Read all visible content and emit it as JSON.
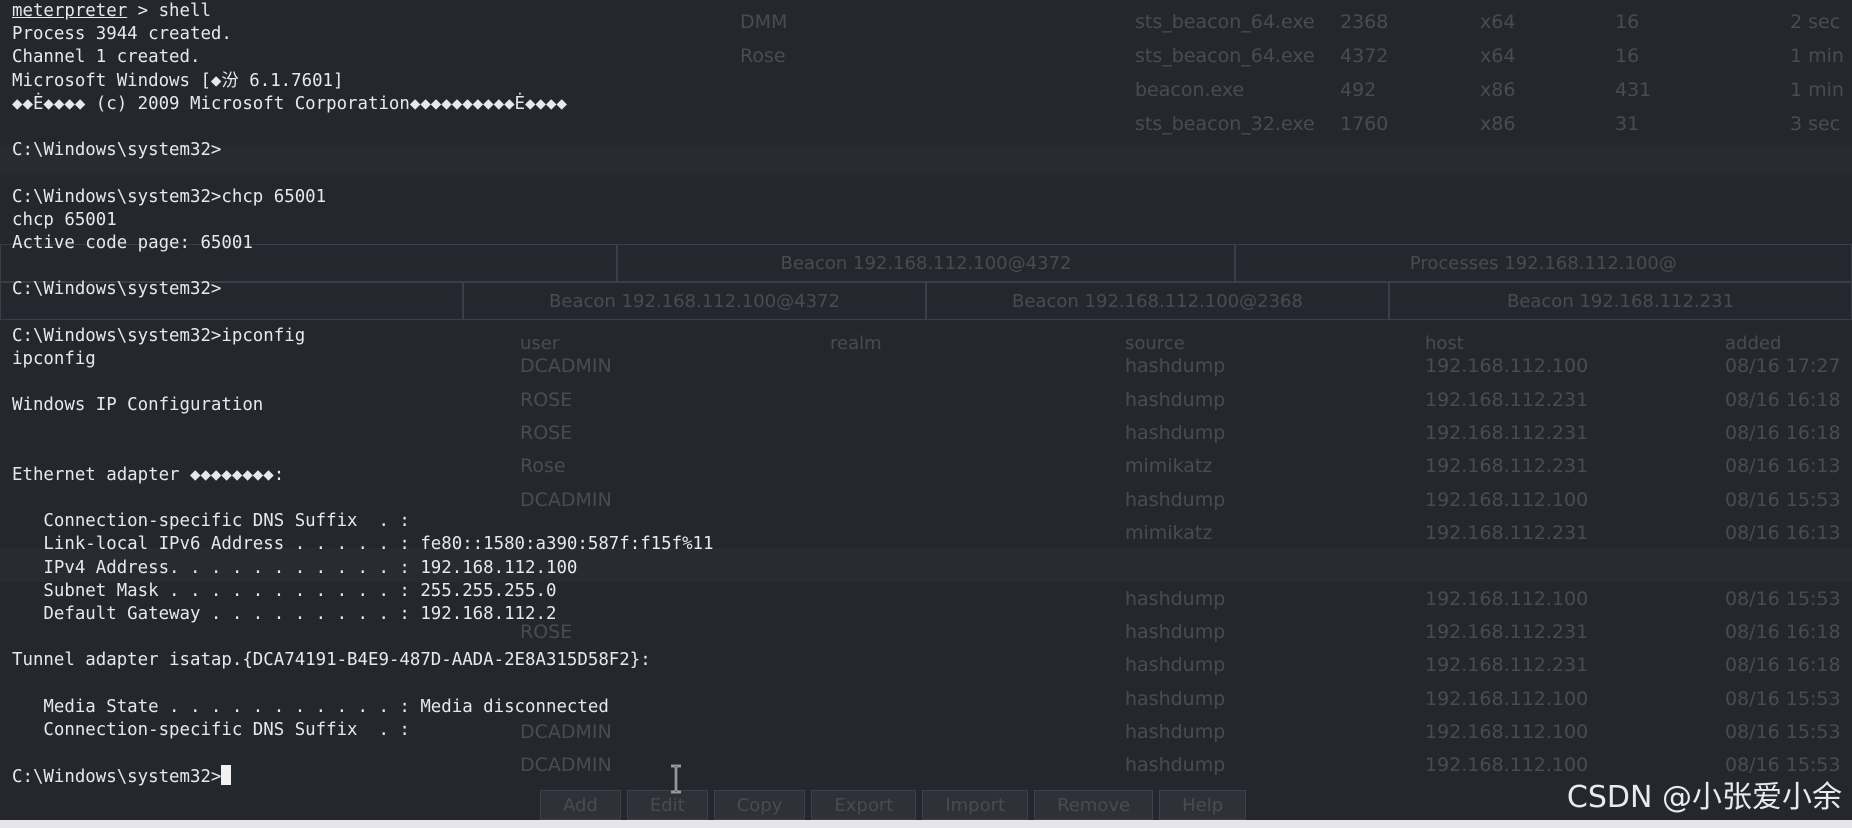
{
  "terminal": {
    "lines": [
      {
        "prefix": "meterpreter",
        "text": " > shell"
      },
      {
        "text": "Process 3944 created."
      },
      {
        "text": "Channel 1 created."
      },
      {
        "text": "Microsoft Windows [◆汾 6.1.7601]"
      },
      {
        "text": "◆◆Ė◆◆◆◆ (c) 2009 Microsoft Corporation◆◆◆◆◆◆◆◆◆◆Ė◆◆◆◆"
      },
      {
        "text": ""
      },
      {
        "text": "C:\\Windows\\system32>"
      },
      {
        "text": ""
      },
      {
        "text": "C:\\Windows\\system32>chcp 65001"
      },
      {
        "text": "chcp 65001"
      },
      {
        "text": "Active code page: 65001"
      },
      {
        "text": ""
      },
      {
        "text": "C:\\Windows\\system32>"
      },
      {
        "text": ""
      },
      {
        "text": "C:\\Windows\\system32>ipconfig"
      },
      {
        "text": "ipconfig"
      },
      {
        "text": ""
      },
      {
        "text": "Windows IP Configuration"
      },
      {
        "text": ""
      },
      {
        "text": ""
      },
      {
        "text": "Ethernet adapter ◆◆◆◆◆◆◆◆:"
      },
      {
        "text": ""
      },
      {
        "text": "   Connection-specific DNS Suffix  . :"
      },
      {
        "text": "   Link-local IPv6 Address . . . . . : fe80::1580:a390:587f:f15f%11"
      },
      {
        "text": "   IPv4 Address. . . . . . . . . . . : 192.168.112.100"
      },
      {
        "text": "   Subnet Mask . . . . . . . . . . . : 255.255.255.0"
      },
      {
        "text": "   Default Gateway . . . . . . . . . : 192.168.112.2"
      },
      {
        "text": ""
      },
      {
        "text": "Tunnel adapter isatap.{DCA74191-B4E9-487D-AADA-2E8A315D58F2}:"
      },
      {
        "text": ""
      },
      {
        "text": "   Media State . . . . . . . . . . . : Media disconnected"
      },
      {
        "text": "   Connection-specific DNS Suffix  . :"
      },
      {
        "text": ""
      },
      {
        "text": "C:\\Windows\\system32>",
        "cursor": true
      }
    ]
  },
  "background": {
    "top_rows": [
      {
        "c1": "DMM",
        "c2": "sts_beacon_64.exe",
        "c3": "2368",
        "c4": "x64",
        "c5": "16",
        "c6": "2 sec"
      },
      {
        "c1": "Rose",
        "c2": "sts_beacon_64.exe",
        "c3": "4372",
        "c4": "x64",
        "c5": "16",
        "c6": "1 min"
      },
      {
        "c1": "",
        "c2": "beacon.exe",
        "c3": "492",
        "c4": "x86",
        "c5": "431",
        "c6": "1 min"
      },
      {
        "c1": "",
        "c2": "sts_beacon_32.exe",
        "c3": "1760",
        "c4": "x86",
        "c5": "31",
        "c6": "3 sec"
      }
    ],
    "tabs_row1": [
      "",
      "Beacon 192.168.112.100@4372",
      "Processes 192.168.112.100@"
    ],
    "tabs_row2": [
      "",
      "Beacon 192.168.112.100@4372",
      "Beacon 192.168.112.100@2368",
      "Beacon 192.168.112.231"
    ],
    "headers": [
      "user",
      "realm",
      "source",
      "host",
      "added"
    ],
    "rows": [
      {
        "user": "DCADMIN",
        "source": "hashdump",
        "host": "192.168.112.100",
        "added": "08/16 17:27"
      },
      {
        "user": "ROSE",
        "source": "hashdump",
        "host": "192.168.112.231",
        "added": "08/16 16:18"
      },
      {
        "user": "ROSE",
        "source": "hashdump",
        "host": "192.168.112.231",
        "added": "08/16 16:18"
      },
      {
        "user": "Rose",
        "source": "mimikatz",
        "host": "192.168.112.231",
        "added": "08/16 16:13"
      },
      {
        "user": "DCADMIN",
        "source": "hashdump",
        "host": "192.168.112.100",
        "added": "08/16 15:53"
      },
      {
        "user": "",
        "source": "mimikatz",
        "host": "192.168.112.231",
        "added": "08/16 16:13"
      },
      {
        "user": "",
        "source": "hashdump",
        "host": "192.168.112.100",
        "added": "08/16 15:53"
      },
      {
        "user": "ROSE",
        "source": "hashdump",
        "host": "192.168.112.231",
        "added": "08/16 16:18"
      },
      {
        "user": "",
        "source": "hashdump",
        "host": "192.168.112.231",
        "added": "08/16 16:18"
      },
      {
        "user": "",
        "source": "hashdump",
        "host": "192.168.112.100",
        "added": "08/16 15:53"
      },
      {
        "user": "DCADMIN",
        "source": "hashdump",
        "host": "192.168.112.100",
        "added": "08/16 15:53"
      },
      {
        "user": "DCADMIN",
        "source": "hashdump",
        "host": "192.168.112.100",
        "added": "08/16 15:53"
      }
    ],
    "buttons": [
      "Add",
      "Edit",
      "Copy",
      "Export",
      "Import",
      "Remove",
      "Help"
    ]
  },
  "watermark": "CSDN @小张爱小余",
  "colors": {
    "background": "#25272e",
    "text": "#e8e8ec"
  }
}
